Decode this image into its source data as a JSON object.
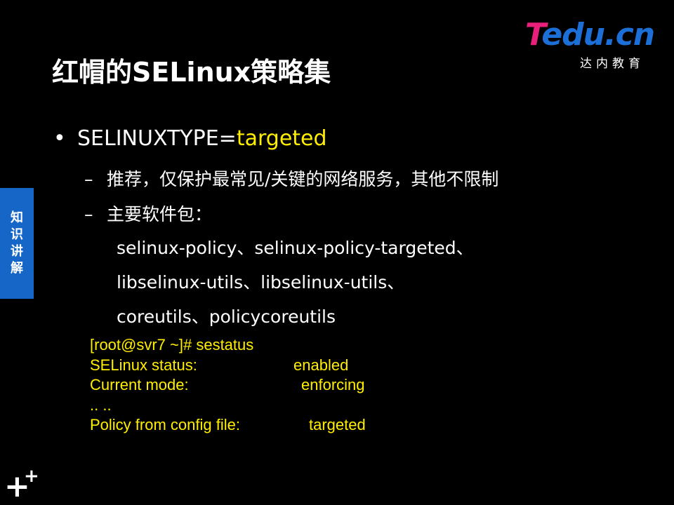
{
  "title": "红帽的SELinux策略集",
  "logo": {
    "part1": "T",
    "part2": "edu.cn",
    "subtitle": "达内教育"
  },
  "side_tab": [
    "知",
    "识",
    "讲",
    "解"
  ],
  "bullet": {
    "dot": "•",
    "prefix": "SELINUXTYPE=",
    "value": "targeted"
  },
  "sub_items": [
    {
      "dash": "–",
      "text": "推荐，仅保护最常见/关键的网络服务，其他不限制"
    },
    {
      "dash": "–",
      "text": "主要软件包："
    }
  ],
  "packages": [
    "selinux-policy、selinux-policy-targeted、",
    "libselinux-utils、libselinux-utils、",
    "coreutils、policycoreutils"
  ],
  "terminal": [
    {
      "label": "[root@svr7 ~]# sestatus",
      "value": ""
    },
    {
      "label": "SELinux status:",
      "value": "enabled"
    },
    {
      "label": "Current mode:",
      "value": "enforcing"
    },
    {
      "label": ".. ..",
      "value": ""
    },
    {
      "label": "Policy from config file:",
      "value": "targeted"
    }
  ],
  "corner_icon": {
    "big": "+",
    "small": "+"
  }
}
